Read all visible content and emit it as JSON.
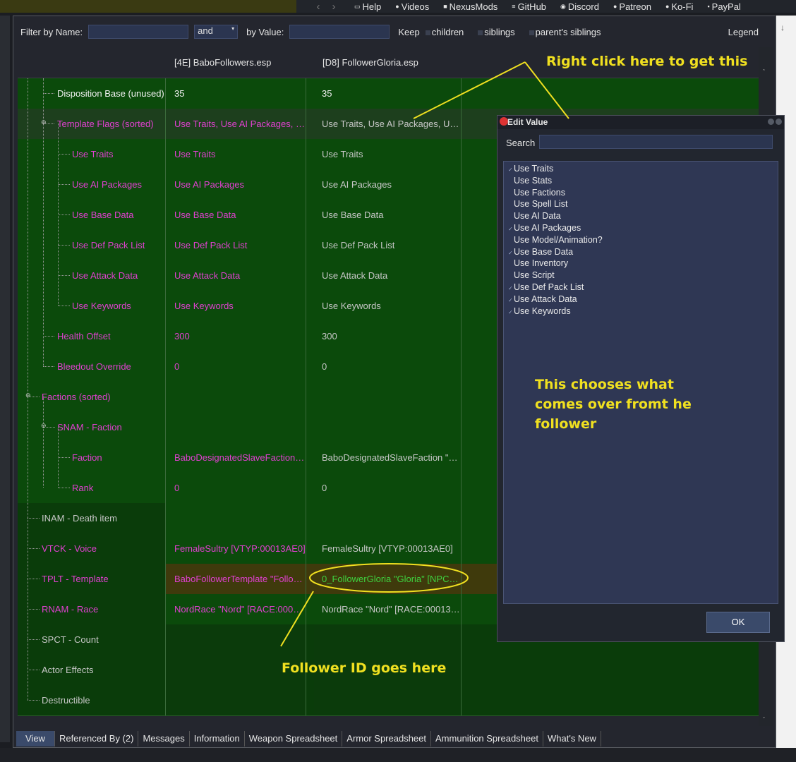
{
  "topbar": {
    "links": [
      {
        "label": "Help",
        "icon": "book-icon",
        "mark": "▭"
      },
      {
        "label": "Videos",
        "icon": "video-icon",
        "mark": "●"
      },
      {
        "label": "NexusMods",
        "icon": "nexus-icon",
        "mark": "■"
      },
      {
        "label": "GitHub",
        "icon": "github-icon",
        "mark": "≡"
      },
      {
        "label": "Discord",
        "icon": "discord-icon",
        "mark": "◉"
      },
      {
        "label": "Patreon",
        "icon": "patreon-icon",
        "mark": "●"
      },
      {
        "label": "Ko-Fi",
        "icon": "kofi-icon",
        "mark": "●"
      },
      {
        "label": "PayPal",
        "icon": "paypal-icon",
        "mark": "▪"
      }
    ]
  },
  "filter": {
    "by_name_label": "Filter by Name:",
    "and_label": "and",
    "by_value_label": "by Value:",
    "keep_label": "Keep",
    "children_label": "children",
    "siblings_label": "siblings",
    "parents_siblings_label": "parent's siblings",
    "legend_label": "Legend"
  },
  "grid": {
    "columns": [
      "",
      "[4E] BaboFollowers.esp",
      "[D8] FollowerGloria.esp"
    ],
    "rows": [
      {
        "label": "Disposition Base (unused)",
        "v1": "35",
        "v2": "35"
      },
      {
        "label": "Template Flags (sorted)",
        "v1": "Use Traits, Use AI Packages, Use Base Data, Use Def Pack List, Use Attack Data, Use Keywords",
        "v2": "Use Traits, Use AI Packages, Use Base Data, Use Def Pack List, Use Attack Data, Use Keywords"
      },
      {
        "label": "Use Traits",
        "v1": "Use Traits",
        "v2": "Use Traits"
      },
      {
        "label": "Use AI Packages",
        "v1": "Use AI Packages",
        "v2": "Use AI Packages"
      },
      {
        "label": "Use Base Data",
        "v1": "Use Base Data",
        "v2": "Use Base Data"
      },
      {
        "label": "Use Def Pack List",
        "v1": "Use Def Pack List",
        "v2": "Use Def Pack List"
      },
      {
        "label": "Use Attack Data",
        "v1": "Use Attack Data",
        "v2": "Use Attack Data"
      },
      {
        "label": "Use Keywords",
        "v1": "Use Keywords",
        "v2": "Use Keywords"
      },
      {
        "label": "Health Offset",
        "v1": "300",
        "v2": "300"
      },
      {
        "label": "Bleedout Override",
        "v1": "0",
        "v2": "0"
      },
      {
        "label": "Factions (sorted)",
        "v1": "",
        "v2": ""
      },
      {
        "label": "SNAM - Faction",
        "v1": "",
        "v2": ""
      },
      {
        "label": "Faction",
        "v1": "BaboDesignatedSlaveFaction \"Ba...",
        "v2": "BaboDesignatedSlaveFaction \"Ba..."
      },
      {
        "label": "Rank",
        "v1": "0",
        "v2": "0"
      },
      {
        "label": "INAM - Death item",
        "v1": "",
        "v2": ""
      },
      {
        "label": "VTCK - Voice",
        "v1": "FemaleSultry [VTYP:00013AE0]",
        "v2": "FemaleSultry [VTYP:00013AE0]"
      },
      {
        "label": "TPLT - Template",
        "v1": "BaboFollowerTemplate \"Follower...",
        "v2": "0_FollowerGloria \"Gloria\" [NPC_:..."
      },
      {
        "label": "RNAM - Race",
        "v1": "NordRace \"Nord\" [RACE:0001374...",
        "v2": "NordRace \"Nord\" [RACE:0001374..."
      },
      {
        "label": "SPCT - Count",
        "v1": "",
        "v2": ""
      },
      {
        "label": "Actor Effects",
        "v1": "",
        "v2": ""
      },
      {
        "label": "Destructible",
        "v1": "",
        "v2": ""
      }
    ]
  },
  "tabs": [
    "View",
    "Referenced By (2)",
    "Messages",
    "Information",
    "Weapon Spreadsheet",
    "Armor Spreadsheet",
    "Ammunition Spreadsheet",
    "What's New"
  ],
  "dialog": {
    "title": "Edit Value",
    "search_label": "Search",
    "items": [
      {
        "label": "Use Traits",
        "checked": true
      },
      {
        "label": "Use Stats",
        "checked": false
      },
      {
        "label": "Use Factions",
        "checked": false
      },
      {
        "label": "Use Spell List",
        "checked": false
      },
      {
        "label": "Use AI Data",
        "checked": false
      },
      {
        "label": "Use AI Packages",
        "checked": true
      },
      {
        "label": "Use Model/Animation?",
        "checked": false
      },
      {
        "label": "Use Base Data",
        "checked": true
      },
      {
        "label": "Use Inventory",
        "checked": false
      },
      {
        "label": "Use Script",
        "checked": false
      },
      {
        "label": "Use Def Pack List",
        "checked": true
      },
      {
        "label": "Use Attack Data",
        "checked": true
      },
      {
        "label": "Use Keywords",
        "checked": true
      }
    ],
    "ok_label": "OK"
  },
  "annotations": {
    "right_click": "Right click here to get this",
    "chooses_1": "This chooses what",
    "chooses_2": "comes over fromt he",
    "chooses_3": "follower",
    "follower_id": "Follower ID goes here"
  },
  "colors": {
    "accent_text": "#e040d0",
    "grey_text": "#c7c7c7",
    "annotation": "#f0e020",
    "green_row": "#0b4a0b",
    "highlight_row": "#3f3a0c",
    "selected_value": "#3fd23f"
  }
}
